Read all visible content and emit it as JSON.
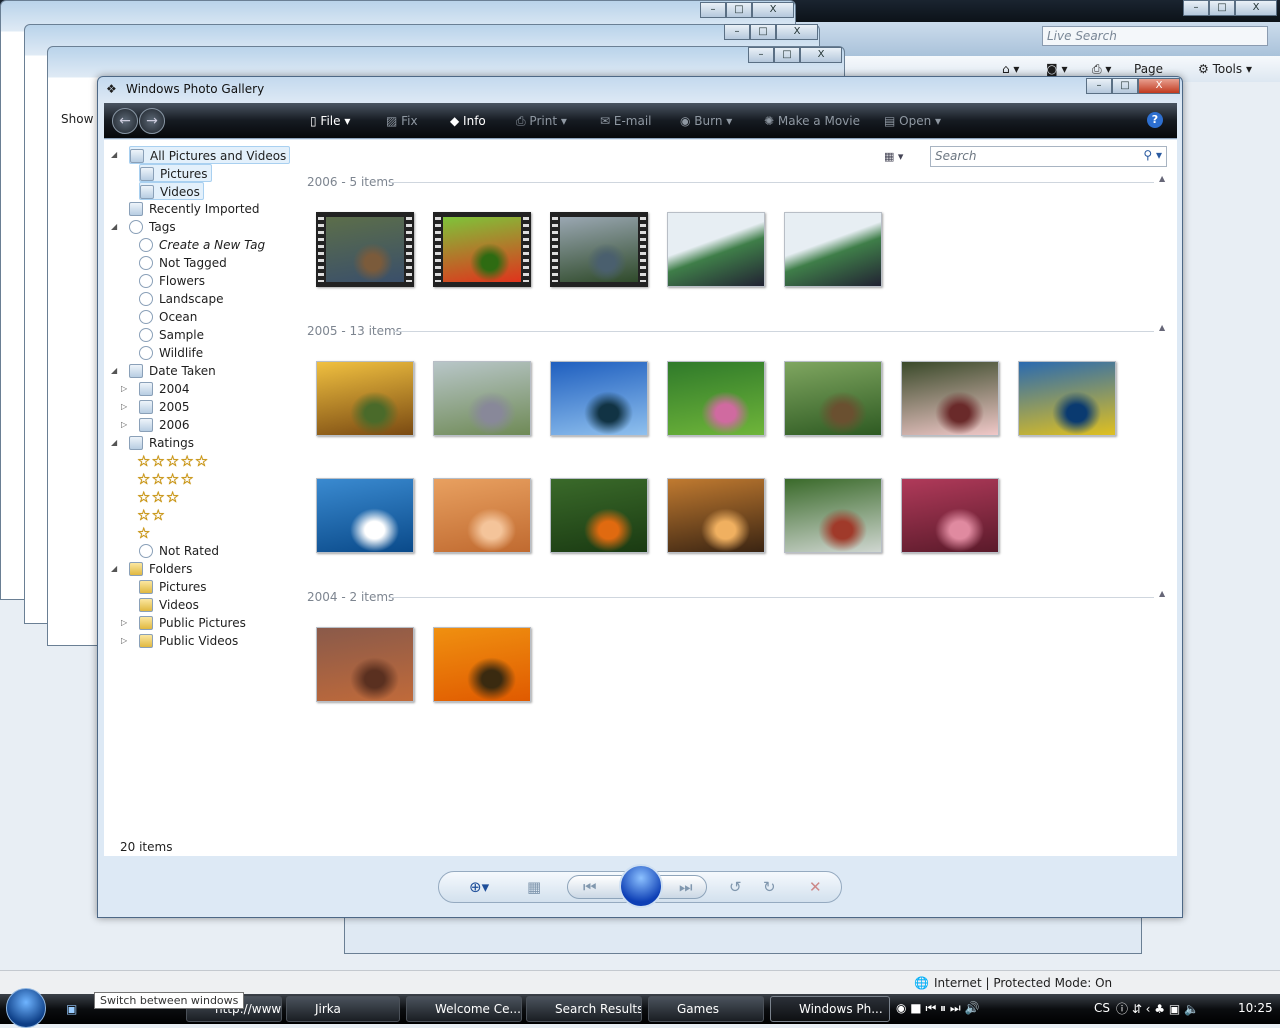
{
  "ie": {
    "live_search_placeholder": "Live Search",
    "page": "Page",
    "tools": "Tools",
    "status": "Internet | Protected Mode: On",
    "show": "Show"
  },
  "window": {
    "title": "Windows Photo Gallery",
    "minimize": "–",
    "maximize": "□",
    "close": "X"
  },
  "toolbar": {
    "items": [
      {
        "label": "File",
        "enabled": true,
        "dropdown": true,
        "icon": "file-icon"
      },
      {
        "label": "Fix",
        "enabled": false,
        "icon": "fix-icon"
      },
      {
        "label": "Info",
        "enabled": true,
        "icon": "info-tag-icon"
      },
      {
        "label": "Print",
        "enabled": false,
        "dropdown": true,
        "icon": "printer-icon"
      },
      {
        "label": "E-mail",
        "enabled": false,
        "icon": "email-icon"
      },
      {
        "label": "Burn",
        "enabled": false,
        "dropdown": true,
        "icon": "burn-disc-icon"
      },
      {
        "label": "Make a Movie",
        "enabled": false,
        "icon": "movie-icon"
      },
      {
        "label": "Open",
        "enabled": false,
        "dropdown": true,
        "icon": "open-icon"
      }
    ],
    "help": "?"
  },
  "search": {
    "placeholder": "Search"
  },
  "sidebar": {
    "all": "All Pictures and Videos",
    "pictures": "Pictures",
    "videos": "Videos",
    "recent": "Recently Imported",
    "tags": "Tags",
    "tag_items": [
      "Create a New Tag",
      "Not Tagged",
      "Flowers",
      "Landscape",
      "Ocean",
      "Sample",
      "Wildlife"
    ],
    "date": "Date Taken",
    "years": [
      "2004",
      "2005",
      "2006"
    ],
    "ratings": "Ratings",
    "rating_levels": [
      5,
      4,
      3,
      2,
      1
    ],
    "not_rated": "Not Rated",
    "folders": "Folders",
    "folder_items": [
      "Pictures",
      "Videos",
      "Public Pictures",
      "Public Videos"
    ]
  },
  "groups": [
    {
      "label": "2006 - 5 items",
      "items": [
        {
          "type": "video",
          "c": [
            "#5c6e4a",
            "#3a4f6a",
            "#7b5b3b"
          ]
        },
        {
          "type": "video",
          "c": [
            "#7ec43a",
            "#e0331c",
            "#2e6b12"
          ]
        },
        {
          "type": "video",
          "c": [
            "#9aa7b2",
            "#2f4a2a",
            "#4a5f6e"
          ]
        },
        {
          "type": "screenshot",
          "c": [
            "#e7eef3",
            "#3f7e49",
            "#223"
          ]
        },
        {
          "type": "screenshot",
          "c": [
            "#e7eef3",
            "#3f7e49",
            "#223"
          ]
        }
      ]
    },
    {
      "label": "2005 - 13 items",
      "items": [
        {
          "type": "photo",
          "c": [
            "#f0c040",
            "#7a4a12",
            "#4a6a2a"
          ]
        },
        {
          "type": "photo",
          "c": [
            "#b8c6c8",
            "#6f8a56",
            "#889"
          ]
        },
        {
          "type": "photo",
          "c": [
            "#1f5fbf",
            "#8fc0ee",
            "#134"
          ]
        },
        {
          "type": "photo",
          "c": [
            "#2f7a2a",
            "#6fb53a",
            "#d06aa0"
          ]
        },
        {
          "type": "photo",
          "c": [
            "#7fa660",
            "#2e5a22",
            "#6a5030"
          ]
        },
        {
          "type": "photo",
          "c": [
            "#3a4a2a",
            "#f0c8c8",
            "#6a2a2a"
          ]
        },
        {
          "type": "photo",
          "c": [
            "#2a6ab0",
            "#e0c020",
            "#0a3a70"
          ]
        },
        {
          "type": "photo",
          "c": [
            "#3a8ad0",
            "#0a4a8a",
            "#fff"
          ]
        },
        {
          "type": "photo",
          "c": [
            "#e8a060",
            "#c06a30",
            "#f4c49a"
          ]
        },
        {
          "type": "photo",
          "c": [
            "#3a6a2a",
            "#1a3a12",
            "#e06a10"
          ]
        },
        {
          "type": "photo",
          "c": [
            "#c07a30",
            "#3a2412",
            "#f0b060"
          ]
        },
        {
          "type": "photo",
          "c": [
            "#3a6a2a",
            "#cfd6d0",
            "#a03a2a"
          ]
        },
        {
          "type": "photo",
          "c": [
            "#b03a5a",
            "#5a1a2a",
            "#e08aa0"
          ]
        }
      ]
    },
    {
      "label": "2004 - 2 items",
      "items": [
        {
          "type": "photo",
          "c": [
            "#8a5a4a",
            "#c06a3a",
            "#5a3020"
          ]
        },
        {
          "type": "photo",
          "c": [
            "#f09010",
            "#e05a00",
            "#3a2a10"
          ]
        }
      ]
    }
  ],
  "status": {
    "count": "20 items"
  },
  "taskbar": {
    "tooltip": "Switch between windows",
    "tasks": [
      {
        "label": "http://www..."
      },
      {
        "label": "Jirka"
      },
      {
        "label": "Welcome Ce..."
      },
      {
        "label": "Search Results"
      },
      {
        "label": "Games"
      },
      {
        "label": "Windows Ph...",
        "active": true
      }
    ],
    "lang": "CS",
    "clock": "10:25"
  }
}
